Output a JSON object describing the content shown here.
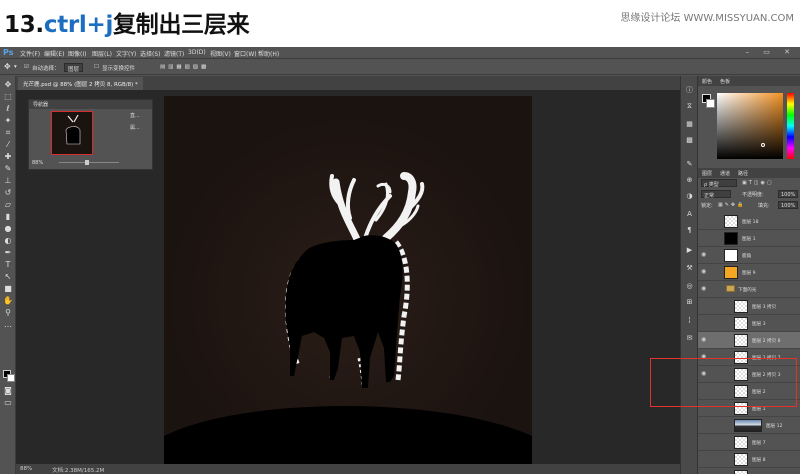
{
  "header": {
    "step": "13.",
    "title_highlight": "ctrl+j",
    "title_rest": "复制出三层来",
    "site": "思缘设计论坛  WWW.MISSYUAN.COM"
  },
  "app": {
    "logo": "Ps",
    "menu": [
      "文件(F)",
      "编辑(E)",
      "图像(I)",
      "图层(L)",
      "文字(Y)",
      "选择(S)",
      "滤镜(T)",
      "3D(D)",
      "视图(V)",
      "窗口(W)",
      "帮助(H)"
    ],
    "window_controls": "– ▭ ✕"
  },
  "options": {
    "auto_select": "自动选择：",
    "auto_select_value": "图层",
    "show_transform": "显示变换控件"
  },
  "document": {
    "tab": "光芒鹿.psd @ 88% (图层 2 拷贝 8, RGB/8) *"
  },
  "navigator": {
    "title": "导航器",
    "zoom": "88%",
    "side_items": [
      "直...",
      "属..."
    ]
  },
  "status": {
    "zoom": "88%",
    "doc_info": "文档:2.38M/165.2M"
  },
  "color_panel": {
    "tabs": [
      "颜色",
      "色板"
    ],
    "fg_color": "#000000",
    "bg_color": "#ffffff",
    "hue_color": "#f39223"
  },
  "layers_panel": {
    "tabs": [
      "图层",
      "通道",
      "路径"
    ],
    "filter_label": "ρ 类型",
    "blend_mode": "正常",
    "opacity_label": "不透明度:",
    "opacity_value": "100%",
    "lock_label": "锁定:",
    "fill_label": "填充:",
    "fill_value": "100%",
    "layers": [
      {
        "name": "图层 18",
        "thumb": "checker",
        "visible": false,
        "selected": false
      },
      {
        "name": "图层 1",
        "thumb": "black",
        "visible": false,
        "selected": false
      },
      {
        "name": "鹿角",
        "thumb": "deer",
        "visible": true,
        "selected": false
      },
      {
        "name": "图层 9",
        "thumb": "orange",
        "visible": true,
        "selected": false
      },
      {
        "name": "下面的光",
        "thumb": "folder",
        "visible": true,
        "selected": false
      },
      {
        "name": "图层 3 拷贝",
        "thumb": "checker",
        "visible": false,
        "selected": false
      },
      {
        "name": "图层 3",
        "thumb": "checker",
        "visible": false,
        "selected": false
      },
      {
        "name": "图层 2 拷贝 8",
        "thumb": "checker",
        "visible": true,
        "selected": true
      },
      {
        "name": "图层 2 拷贝 7",
        "thumb": "checker",
        "visible": true,
        "selected": false
      },
      {
        "name": "图层 2 拷贝 3",
        "thumb": "checker",
        "visible": true,
        "selected": false
      },
      {
        "name": "图层 2",
        "thumb": "checker",
        "visible": false,
        "selected": false
      },
      {
        "name": "图层 1",
        "thumb": "checker",
        "visible": false,
        "selected": false
      },
      {
        "name": "图层 12",
        "thumb": "wide",
        "visible": false,
        "selected": false
      },
      {
        "name": "图层 7",
        "thumb": "checker",
        "visible": false,
        "selected": false
      },
      {
        "name": "图层 8",
        "thumb": "checker",
        "visible": false,
        "selected": false
      },
      {
        "name": "图层 6",
        "thumb": "checker",
        "visible": false,
        "selected": false
      }
    ]
  },
  "annotation": {
    "highlight_color": "#e0332c"
  }
}
